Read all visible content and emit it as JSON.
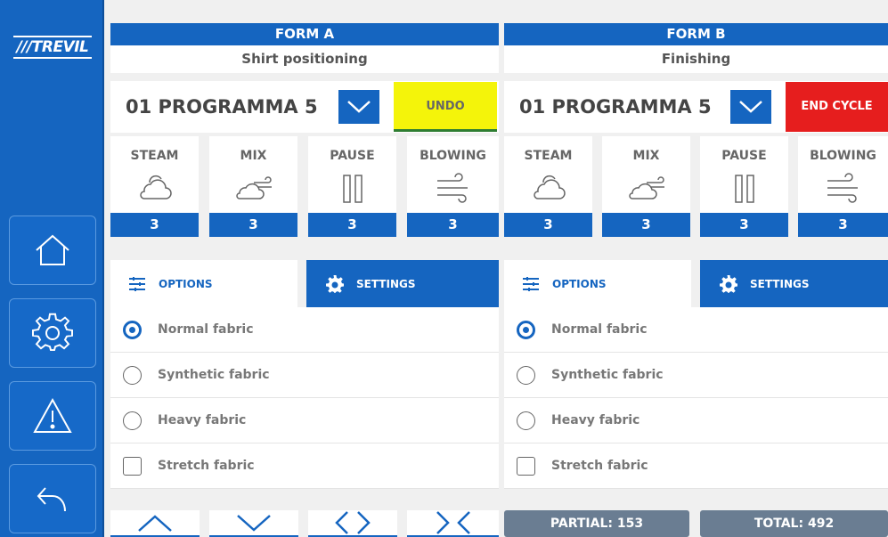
{
  "brand": {
    "logo_text": "///TREVIL"
  },
  "sidebar": {
    "buttons": [
      {
        "icon": "home-icon"
      },
      {
        "icon": "gear-icon"
      },
      {
        "icon": "warning-icon"
      },
      {
        "icon": "back-icon"
      }
    ]
  },
  "colors": {
    "primary": "#1565c0",
    "undo": "#f4f40a",
    "end_cycle": "#e61e1e",
    "counter": "#6a7d92"
  },
  "form_a": {
    "title": "FORM A",
    "subtitle": "Shirt positioning",
    "program": "01 PROGRAMMA 5",
    "action_label": "UNDO",
    "params": [
      {
        "label": "STEAM",
        "icon": "cloud-icon",
        "value": "3"
      },
      {
        "label": "MIX",
        "icon": "cloud-wind-icon",
        "value": "3"
      },
      {
        "label": "PAUSE",
        "icon": "pause-icon",
        "value": "3"
      },
      {
        "label": "BLOWING",
        "icon": "wind-icon",
        "value": "3"
      }
    ],
    "tabs": {
      "options": "OPTIONS",
      "settings": "SETTINGS"
    },
    "options": [
      {
        "label": "Normal fabric",
        "type": "radio",
        "selected": true
      },
      {
        "label": "Synthetic fabric",
        "type": "radio",
        "selected": false
      },
      {
        "label": "Heavy fabric",
        "type": "radio",
        "selected": false
      },
      {
        "label": "Stretch fabric",
        "type": "checkbox",
        "selected": false
      }
    ],
    "nav_buttons": [
      "chevron-up-icon",
      "chevron-down-icon",
      "expand-icon",
      "collapse-icon"
    ]
  },
  "form_b": {
    "title": "FORM B",
    "subtitle": "Finishing",
    "program": "01 PROGRAMMA 5",
    "action_label": "END CYCLE",
    "params": [
      {
        "label": "STEAM",
        "icon": "cloud-icon",
        "value": "3"
      },
      {
        "label": "MIX",
        "icon": "cloud-wind-icon",
        "value": "3"
      },
      {
        "label": "PAUSE",
        "icon": "pause-icon",
        "value": "3"
      },
      {
        "label": "BLOWING",
        "icon": "wind-icon",
        "value": "3"
      }
    ],
    "tabs": {
      "options": "OPTIONS",
      "settings": "SETTINGS"
    },
    "options": [
      {
        "label": "Normal fabric",
        "type": "radio",
        "selected": true
      },
      {
        "label": "Synthetic fabric",
        "type": "radio",
        "selected": false
      },
      {
        "label": "Heavy fabric",
        "type": "radio",
        "selected": false
      },
      {
        "label": "Stretch fabric",
        "type": "checkbox",
        "selected": false
      }
    ],
    "counters": {
      "partial": "PARTIAL: 153",
      "total": "TOTAL: 492"
    }
  }
}
